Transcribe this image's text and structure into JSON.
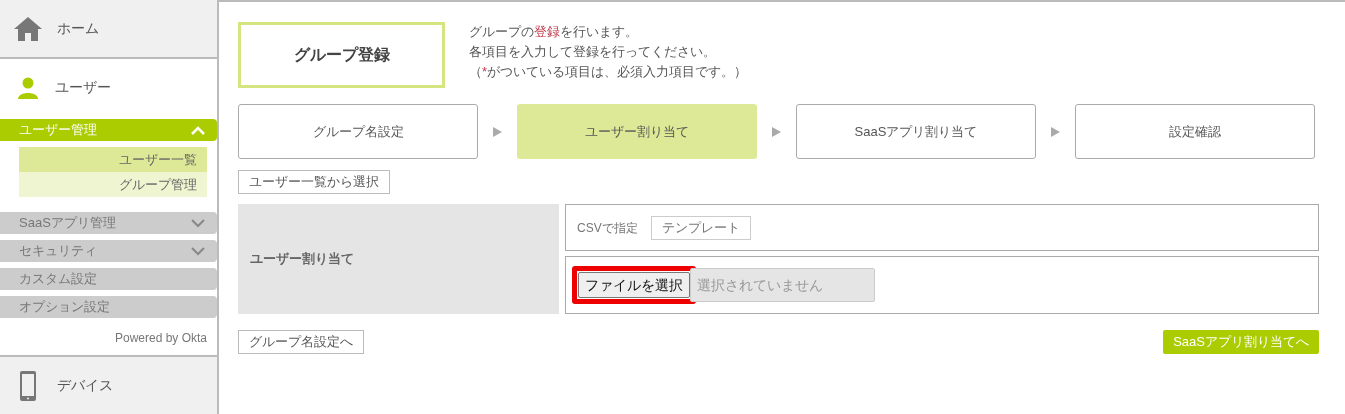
{
  "sidebar": {
    "home": {
      "label": "ホーム"
    },
    "user": {
      "label": "ユーザー"
    },
    "menu": [
      {
        "label": "ユーザー管理",
        "kind": "group",
        "expanded": true,
        "children": [
          {
            "label": "ユーザー一覧",
            "selected": true
          },
          {
            "label": "グループ管理",
            "selected": false
          }
        ]
      },
      {
        "label": "SaaSアプリ管理",
        "kind": "group",
        "expanded": false
      },
      {
        "label": "セキュリティ",
        "kind": "group",
        "expanded": false
      },
      {
        "label": "カスタム設定",
        "kind": "link"
      },
      {
        "label": "オプション設定",
        "kind": "link"
      }
    ],
    "powered_by": "Powered by Okta",
    "device": {
      "label": "デバイス"
    }
  },
  "page_title": "グループ登録",
  "description": [
    [
      {
        "text": "グループの",
        "emphasis": false
      },
      {
        "text": "登録",
        "emphasis": true
      },
      {
        "text": "を行います。",
        "emphasis": false
      }
    ],
    [
      {
        "text": "各項目を入力して登録を行ってください。",
        "emphasis": false
      }
    ],
    [
      {
        "text": "（",
        "emphasis": false
      },
      {
        "text": "*",
        "emphasis": true
      },
      {
        "text": "がついている項目は、必須入力項目です。）",
        "emphasis": false
      }
    ]
  ],
  "steps": [
    {
      "label": "グループ名設定",
      "selected": false
    },
    {
      "label": "ユーザー割り当て",
      "selected": true
    },
    {
      "label": "SaaSアプリ割り当て",
      "selected": false
    },
    {
      "label": "設定確認",
      "selected": false
    }
  ],
  "select_from_list_button": "ユーザー一覧から選択",
  "form": {
    "label": "ユーザー割り当て",
    "csv_label": "CSVで指定",
    "template_button": "テンプレート",
    "file_input": {
      "button": "ファイルを選択",
      "status": "選択されていません",
      "highlighted": true
    }
  },
  "back_button": "グループ名設定へ",
  "next_button": "SaaSアプリ割り当てへ"
}
